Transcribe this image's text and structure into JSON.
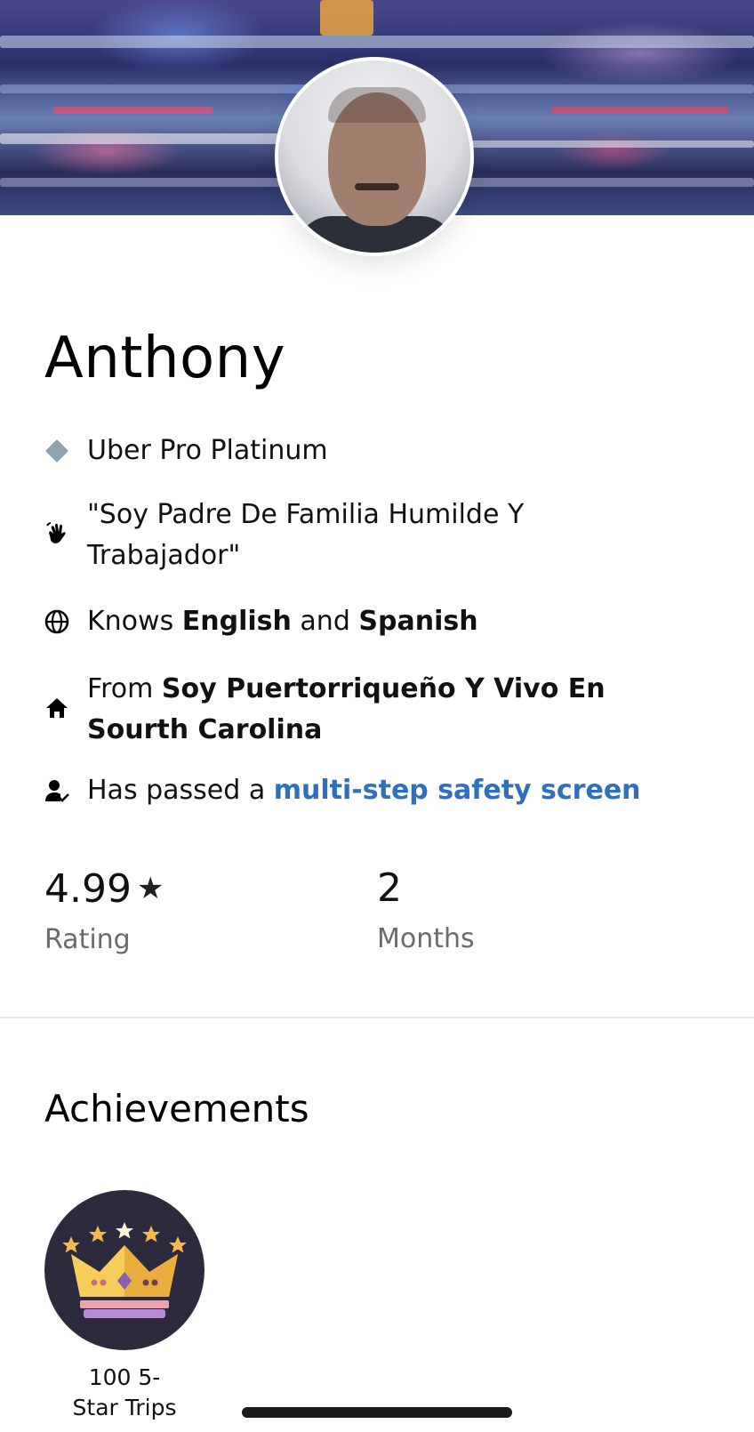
{
  "profile": {
    "name": "Anthony",
    "tier": "Uber Pro Platinum",
    "quote_line1": "\"Soy Padre De Familia Humilde Y",
    "quote_line2": "Trabajador\"",
    "languages_prefix": "Knows",
    "language_1": "English",
    "languages_and": "and",
    "language_2": "Spanish",
    "from_prefix": "From",
    "from_line1": "Soy Puertorriqueño Y Vivo En",
    "from_line2": "Sourth Carolina",
    "safety_prefix": "Has passed a",
    "safety_link": "multi-step safety screen"
  },
  "stats": {
    "rating_value": "4.99",
    "rating_star": "★",
    "rating_label": "Rating",
    "months_value": "2",
    "months_label": "Months"
  },
  "achievements": {
    "title": "Achievements",
    "items": [
      {
        "caption_line1": "100 5-",
        "caption_line2": "Star Trips"
      }
    ]
  },
  "icons": {
    "tier": "diamond-icon",
    "quote": "waving-hand-icon",
    "languages": "globe-icon",
    "from": "home-icon",
    "safety": "person-check-icon"
  },
  "colors": {
    "link": "#2f6fbf",
    "tier_diamond": "#8fa3b0",
    "badge_bg": "#2e2a3e",
    "crown_gold": "#f4b94a"
  }
}
